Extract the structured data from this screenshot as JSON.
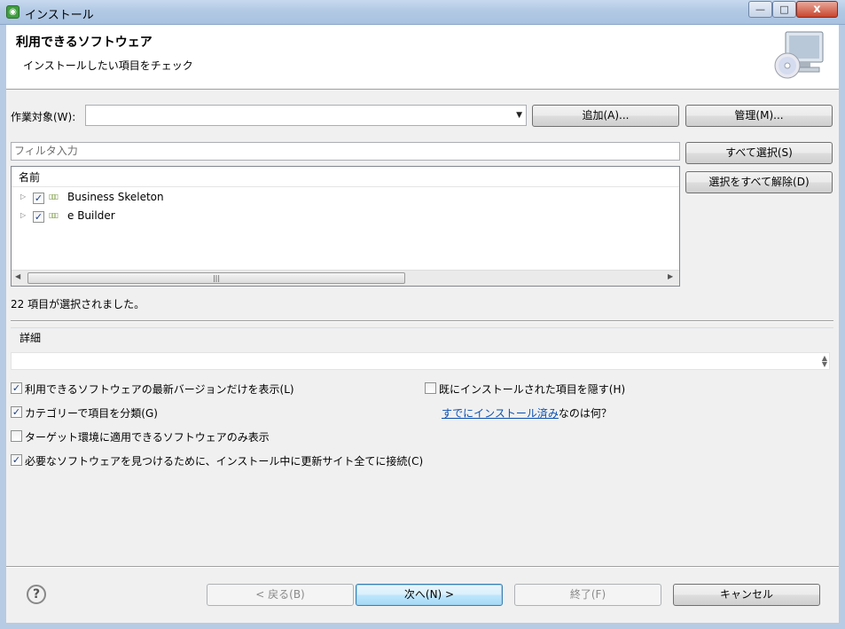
{
  "window": {
    "title": "インストール",
    "minimize": "—",
    "maximize": "□",
    "close": "x"
  },
  "header": {
    "title": "利用できるソフトウェア",
    "subtitle": "インストールしたい項目をチェック"
  },
  "work_with": {
    "label": "作業対象(W):",
    "value": "",
    "add_button": "追加(A)...",
    "manage_button": "管理(M)..."
  },
  "filter": {
    "placeholder": "フィルタ入力"
  },
  "side_buttons": {
    "select_all": "すべて選択(S)",
    "deselect_all": "選択をすべて解除(D)"
  },
  "tree": {
    "column_header": "名前",
    "items": [
      {
        "label": "Business Skeleton",
        "checked": true,
        "icon": "package-icon"
      },
      {
        "label": "e Builder",
        "checked": true,
        "icon": "package-icon"
      }
    ]
  },
  "status": {
    "selected_text": "22 項目が選択されました。"
  },
  "details": {
    "label": "詳細",
    "value": ""
  },
  "options": {
    "latest_only": {
      "label": "利用できるソフトウェアの最新バージョンだけを表示(L)",
      "checked": true
    },
    "group_by_category": {
      "label": "カテゴリーで項目を分類(G)",
      "checked": true
    },
    "target_env_only": {
      "label": "ターゲット環境に適用できるソフトウェアのみ表示",
      "checked": false
    },
    "contact_all_sites": {
      "label": "必要なソフトウェアを見つけるために、インストール中に更新サイト全てに接続(C)",
      "checked": true
    },
    "hide_installed": {
      "label": "既にインストールされた項目を隠す(H)",
      "checked": false
    },
    "already_installed_link": "すでにインストール済み",
    "already_installed_suffix": "なのは何？"
  },
  "footer": {
    "help": "?",
    "back": "< 戻る(B)",
    "next": "次へ(N) >",
    "finish": "終了(F)",
    "cancel": "キャンセル"
  }
}
